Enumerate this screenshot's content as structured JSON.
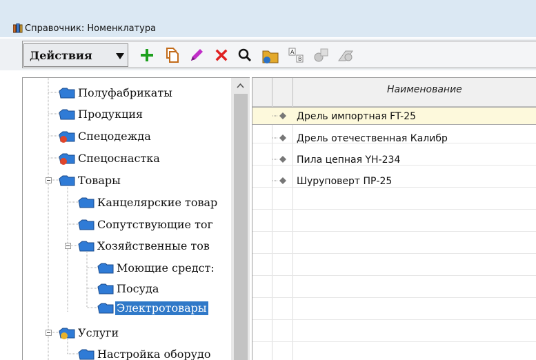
{
  "window": {
    "title": "Справочник: Номенклатура",
    "title_icon": "catalog-books-icon"
  },
  "toolbar": {
    "actions_label": "Действия",
    "buttons": [
      {
        "name": "add-button",
        "icon": "plus-icon"
      },
      {
        "name": "copy-button",
        "icon": "copy-icon"
      },
      {
        "name": "edit-button",
        "icon": "pencil-icon"
      },
      {
        "name": "delete-button",
        "icon": "delete-cross-icon"
      },
      {
        "name": "find-button",
        "icon": "magnifier-icon"
      },
      {
        "name": "hierarchy-button",
        "icon": "folder-hierarchy-icon"
      },
      {
        "name": "sort-button",
        "icon": "sort-ab-icon"
      },
      {
        "name": "settings-button",
        "icon": "disabled-settings-icon"
      },
      {
        "name": "history-button",
        "icon": "disabled-history-icon"
      }
    ],
    "colors": {
      "add": "#1ea01e",
      "delete": "#e02020",
      "edit": "#c02ec8"
    }
  },
  "tree": {
    "items": [
      {
        "label": "Полуфабрикаты",
        "icon": "folder-blue-icon"
      },
      {
        "label": "Продукция",
        "icon": "folder-blue-icon"
      },
      {
        "label": "Спецодежда",
        "icon": "folder-marked-icon"
      },
      {
        "label": "Спецоснастка",
        "icon": "folder-marked-icon"
      },
      {
        "label": "Товары",
        "icon": "folder-blue-icon"
      },
      {
        "label": "Канцелярские товар",
        "icon": "folder-blue-icon"
      },
      {
        "label": "Сопутствующие тог",
        "icon": "folder-blue-icon"
      },
      {
        "label": "Хозяйственные тов",
        "icon": "folder-blue-icon"
      },
      {
        "label": "Моющие средст:",
        "icon": "folder-blue-icon"
      },
      {
        "label": "Посуда",
        "icon": "folder-blue-icon"
      },
      {
        "label": "Электротовары",
        "icon": "folder-blue-icon",
        "selected": true
      },
      {
        "label": "Услуги",
        "icon": "folder-service-icon"
      },
      {
        "label": "Настройка оборудо",
        "icon": "folder-blue-icon"
      }
    ]
  },
  "grid": {
    "column_header": "Наименование",
    "rows": [
      {
        "name": "Дрель импортная FT-25",
        "selected": true
      },
      {
        "name": "Дрель отечественная Калибр"
      },
      {
        "name": "Пила цепная YH-234"
      },
      {
        "name": "Шуруповерт ПР-25"
      }
    ]
  },
  "colors": {
    "selection": "#3079c8",
    "row_highlight": "#fdf9dc",
    "title_bar": "#dbe8f3"
  }
}
